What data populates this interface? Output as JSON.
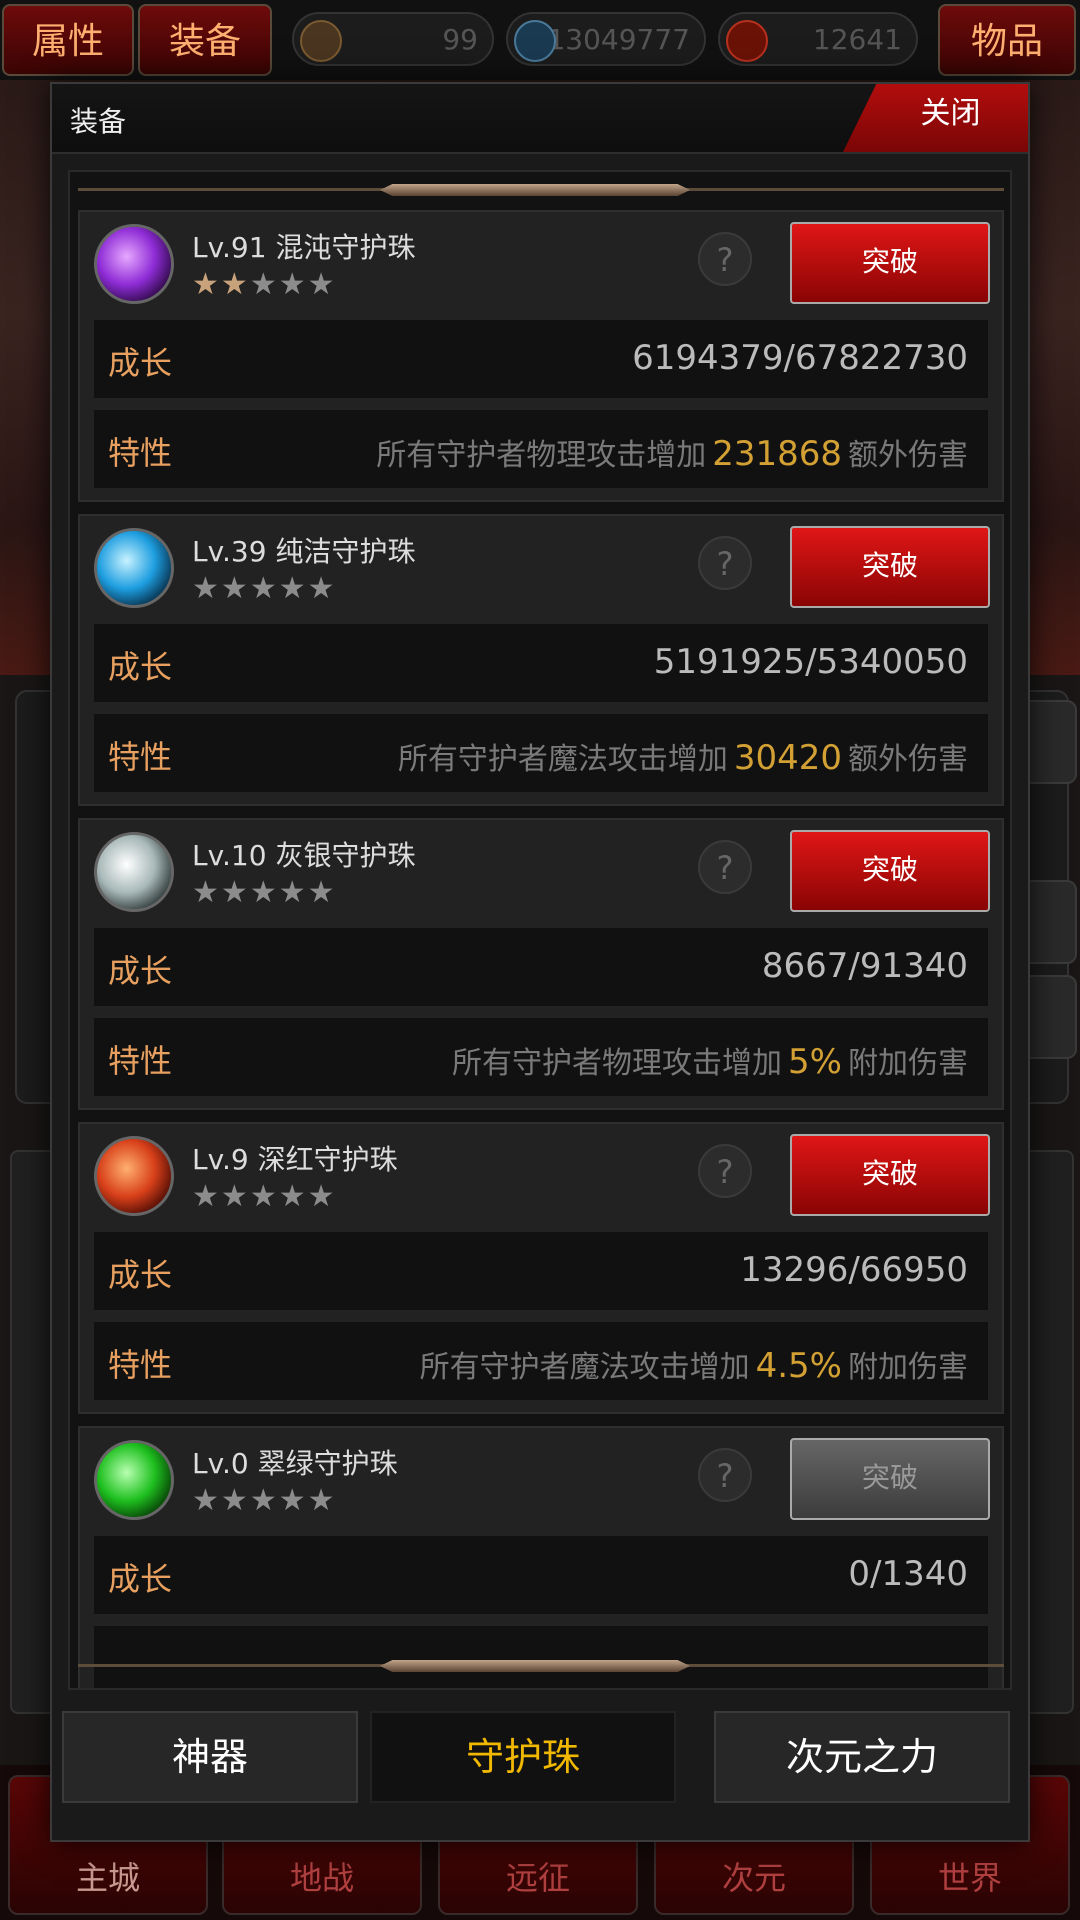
{
  "topbar": {
    "left_tabs": [
      "属性",
      "装备"
    ],
    "right_tab": "物品",
    "resources": [
      {
        "icon": "hexagram-icon",
        "value": "99",
        "color": "#7a5a30"
      },
      {
        "icon": "skull-icon",
        "value": "13049777",
        "color": "#4a7a9a"
      },
      {
        "icon": "swirl-icon",
        "value": "12641",
        "color": "#b8301e"
      }
    ]
  },
  "modal": {
    "title": "装备",
    "close_label": "关闭",
    "growth_label": "成长",
    "trait_label": "特性",
    "break_label": "突破",
    "help_glyph": "?",
    "orbs": [
      {
        "level": "Lv.91",
        "name": "混沌守护珠",
        "stars": 2,
        "max_stars": 5,
        "growth": "6194379/67822730",
        "trait_prefix": "所有守护者物理攻击增加",
        "trait_value": "231868",
        "trait_suffix": "额外伤害",
        "color": "#8e2cd6",
        "break_enabled": true
      },
      {
        "level": "Lv.39",
        "name": "纯洁守护珠",
        "stars": 0,
        "max_stars": 5,
        "growth": "5191925/5340050",
        "trait_prefix": "所有守护者魔法攻击增加",
        "trait_value": "30420",
        "trait_suffix": "额外伤害",
        "color": "#1e9ee0",
        "break_enabled": true
      },
      {
        "level": "Lv.10",
        "name": "灰银守护珠",
        "stars": 0,
        "max_stars": 5,
        "growth": "8667/91340",
        "trait_prefix": "所有守护者物理攻击增加",
        "trait_value": "5%",
        "trait_suffix": "附加伤害",
        "color": "#a8b8b8",
        "break_enabled": true
      },
      {
        "level": "Lv.9",
        "name": "深红守护珠",
        "stars": 0,
        "max_stars": 5,
        "growth": "13296/66950",
        "trait_prefix": "所有守护者魔法攻击增加",
        "trait_value": "4.5%",
        "trait_suffix": "附加伤害",
        "color": "#d8401a",
        "break_enabled": true
      },
      {
        "level": "Lv.0",
        "name": "翠绿守护珠",
        "stars": 0,
        "max_stars": 5,
        "growth": "0/1340",
        "color": "#1fc020",
        "break_enabled": false
      }
    ],
    "bottom_tabs": [
      "神器",
      "守护珠",
      "次元之力"
    ],
    "active_tab": 1
  },
  "bottom_nav": [
    "主城",
    "地战",
    "远征",
    "次元",
    "世界"
  ]
}
